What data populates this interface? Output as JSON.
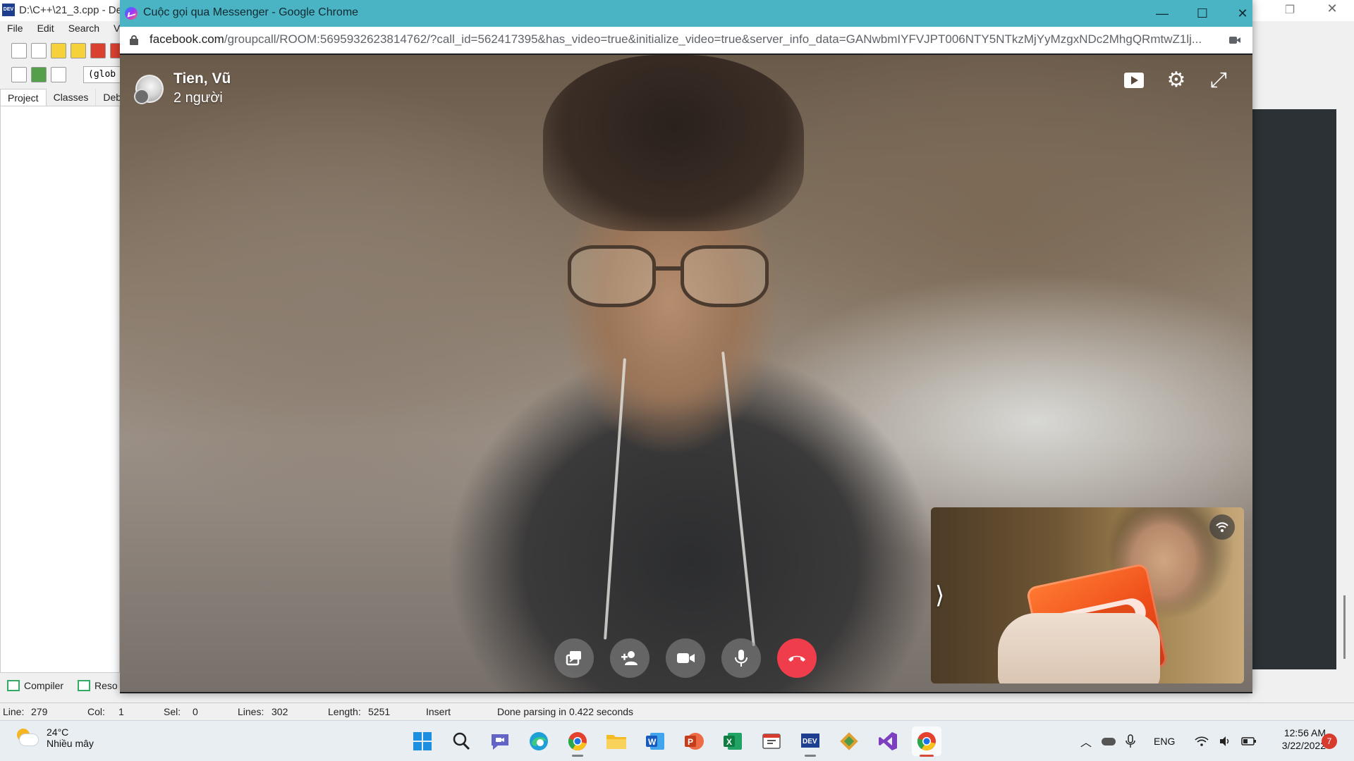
{
  "ide": {
    "title": "D:\\C++\\21_3.cpp - De",
    "menu": [
      "File",
      "Edit",
      "Search",
      "Vi"
    ],
    "scope_combo": "(glob",
    "left_tabs": [
      "Project",
      "Classes",
      "Debu"
    ],
    "bottom_tabs": [
      "Compiler",
      "Reso"
    ],
    "status": {
      "line_label": "Line:",
      "line_value": "279",
      "col_label": "Col:",
      "col_value": "1",
      "sel_label": "Sel:",
      "sel_value": "0",
      "lines_label": "Lines:",
      "lines_value": "302",
      "length_label": "Length:",
      "length_value": "5251",
      "mode": "Insert",
      "message": "Done parsing in 0.422 seconds"
    }
  },
  "chrome": {
    "title": "Cuộc gọi qua Messenger - Google Chrome",
    "url_host": "facebook.com",
    "url_path": "/groupcall/ROOM:5695932623814762/?call_id=562417395&has_video=true&initialize_video=true&server_info_data=GANwbmIYFVJPT006NTY5NTkzMjYyMzgxNDc2MhgQRmtwZ1lj..."
  },
  "call": {
    "caller_name": "Tien, Vũ",
    "participants": "2 người",
    "controls": [
      "share-screen",
      "add-person",
      "video",
      "microphone",
      "end-call"
    ]
  },
  "taskbar": {
    "temperature": "24°C",
    "weather": "Nhiều mây",
    "apps": [
      "windows-start",
      "search",
      "chat",
      "edge",
      "chrome",
      "file-explorer",
      "word",
      "powerpoint",
      "excel",
      "snip",
      "dev-cpp",
      "git",
      "visual-studio",
      "chrome-active"
    ],
    "language": "ENG",
    "time": "12:56 AM",
    "date": "3/22/2022",
    "notifications": "7"
  },
  "colors": {
    "chrome_titlebar": "#4ab3c4",
    "end_call": "#f03d4c",
    "taskbar": "#e9eef3"
  }
}
